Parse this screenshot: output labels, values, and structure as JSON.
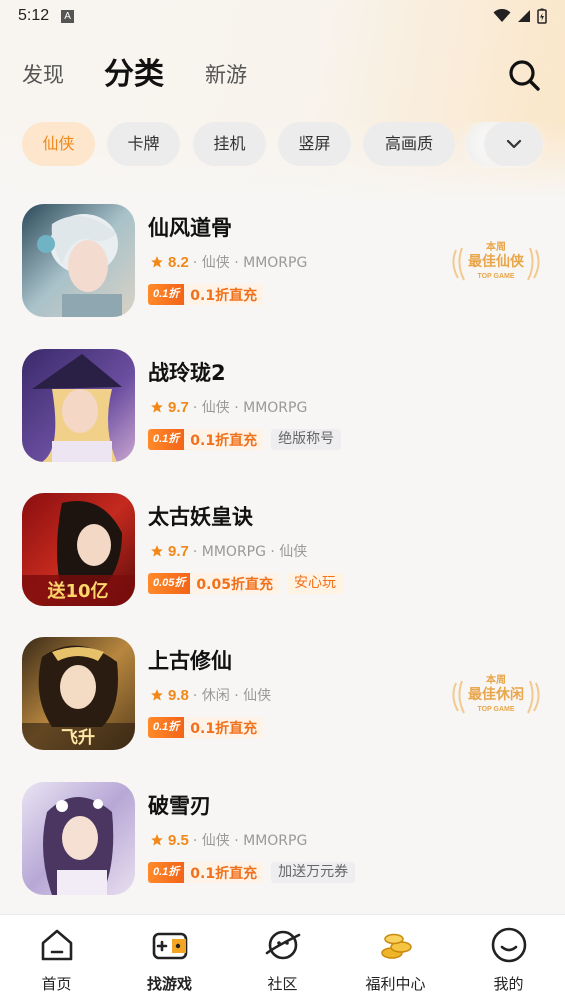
{
  "status_bar": {
    "time": "5:12",
    "notification_letter": "A"
  },
  "header": {
    "tabs": [
      "发现",
      "分类",
      "新游"
    ],
    "active_tab": "分类"
  },
  "categories": {
    "items": [
      "仙侠",
      "卡牌",
      "挂机",
      "竖屏",
      "高画质"
    ],
    "active": "仙侠"
  },
  "games": [
    {
      "name": "仙风道骨",
      "rating": "8.2",
      "meta": "· 仙侠 · MMORPG",
      "discount_badge": "0.1折",
      "discount_text": "0.1折直充",
      "extra_tag": "",
      "award": {
        "line1": "本周",
        "line2": "最佳仙侠",
        "line3": "TOP GAME"
      }
    },
    {
      "name": "战玲珑2",
      "rating": "9.7",
      "meta": "· 仙侠 · MMORPG",
      "discount_badge": "0.1折",
      "discount_text": "0.1折直充",
      "extra_tag": "绝版称号"
    },
    {
      "name": "太古妖皇诀",
      "rating": "9.7",
      "meta": "· MMORPG · 仙侠",
      "discount_badge": "0.05折",
      "discount_text": "0.05折直充",
      "extra_tag": "安心玩",
      "icon_caption": "送10亿"
    },
    {
      "name": "上古修仙",
      "rating": "9.8",
      "meta": "· 休闲 · 仙侠",
      "discount_badge": "0.1折",
      "discount_text": "0.1折直充",
      "extra_tag": "",
      "award": {
        "line1": "本周",
        "line2": "最佳休闲",
        "line3": "TOP GAME"
      },
      "icon_caption": "飞升"
    },
    {
      "name": "破雪刃",
      "rating": "9.5",
      "meta": "· 仙侠 · MMORPG",
      "discount_badge": "0.1折",
      "discount_text": "0.1折直充",
      "extra_tag": "加送万元券"
    }
  ],
  "bottom_nav": {
    "items": [
      "首页",
      "找游戏",
      "社区",
      "福利中心",
      "我的"
    ],
    "active": "找游戏"
  },
  "colors": {
    "accent": "#f0891a",
    "chip_active_bg": "#fde6cc",
    "award_gold": "#e9a64b"
  }
}
